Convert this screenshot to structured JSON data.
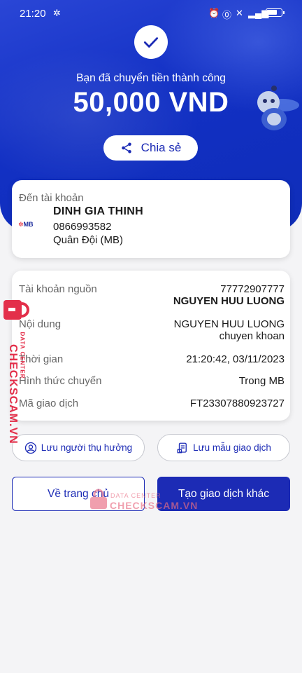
{
  "status_bar": {
    "time": "21:20"
  },
  "success": {
    "message": "Bạn đã chuyển tiền thành công",
    "amount": "50,000 VND",
    "share_label": "Chia sẻ"
  },
  "recipient": {
    "label": "Đến tài khoản",
    "bank_logo": "MB",
    "name": "DINH GIA THINH",
    "account_number": "0866993582",
    "bank_name": "Quân Đội (MB)"
  },
  "details": {
    "source_label": "Tài khoản nguồn",
    "source_account": "77772907777",
    "source_name": "NGUYEN HUU LUONG",
    "content_label": "Nội dung",
    "content_line1": "NGUYEN HUU LUONG",
    "content_line2": "chuyen khoan",
    "time_label": "Thời gian",
    "time_value": "21:20:42, 03/11/2023",
    "method_label": "Hình thức chuyển",
    "method_value": "Trong MB",
    "txn_label": "Mã giao dịch",
    "txn_value": "FT23307880923727"
  },
  "actions": {
    "save_beneficiary": "Lưu người thụ hưởng",
    "save_template": "Lưu mẫu giao dịch",
    "home": "Về trang chủ",
    "new_transaction": "Tạo giao dịch khác"
  },
  "watermark": {
    "brand": "CHECKSCAM.VN",
    "sub": "DATA CENTER"
  },
  "colors": {
    "primary": "#1c2bb5",
    "hero": "#1230c4",
    "watermark": "#e32f4a"
  }
}
